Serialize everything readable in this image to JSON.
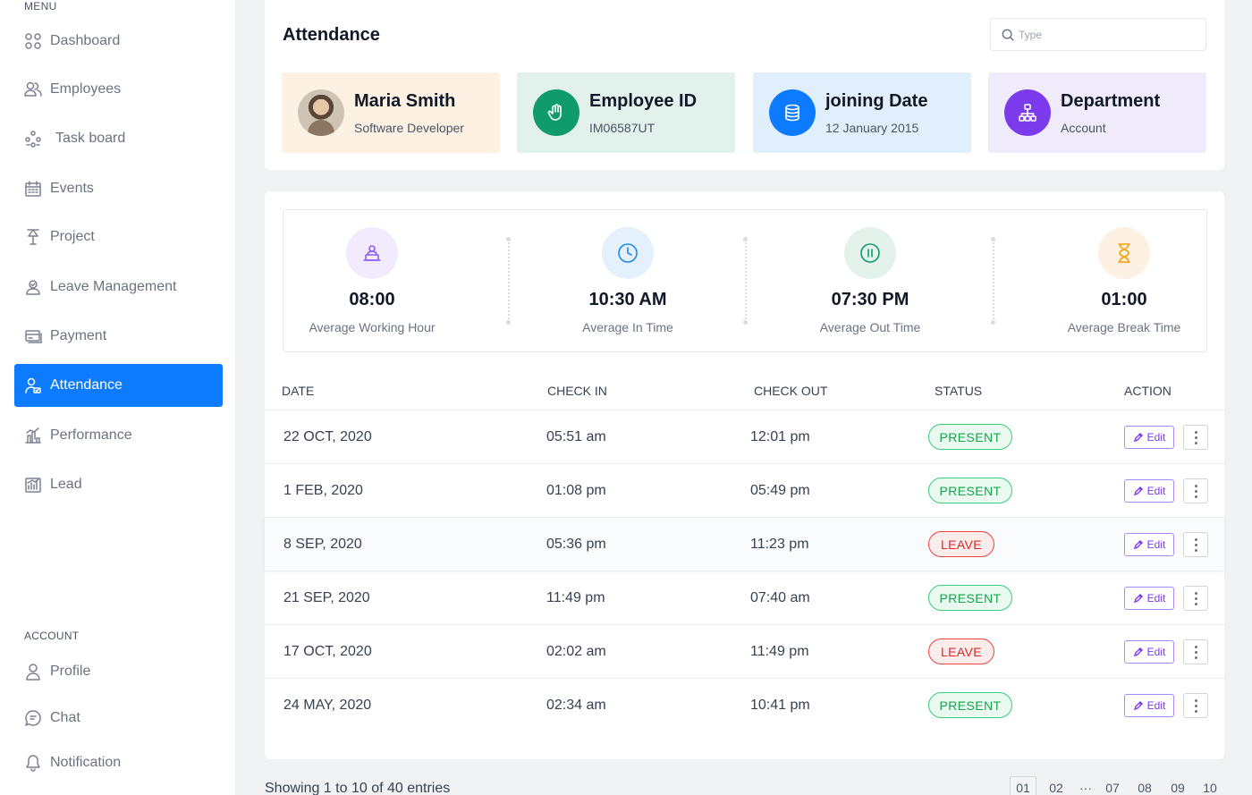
{
  "sidebar": {
    "menu_label": "MENU",
    "account_label": "ACCOUNT",
    "items": [
      {
        "label": "Dashboard",
        "icon": "grid-icon"
      },
      {
        "label": "Employees",
        "icon": "users-icon"
      },
      {
        "label": "Task board",
        "icon": "task-board-icon"
      },
      {
        "label": "Events",
        "icon": "calendar-icon"
      },
      {
        "label": "Project",
        "icon": "project-icon"
      },
      {
        "label": "Leave Management",
        "icon": "leave-icon"
      },
      {
        "label": "Payment",
        "icon": "payment-icon"
      },
      {
        "label": "Attendance",
        "icon": "attendance-icon",
        "active": true
      },
      {
        "label": "Performance",
        "icon": "performance-icon"
      },
      {
        "label": "Lead",
        "icon": "lead-icon"
      }
    ],
    "account_items": [
      {
        "label": "Profile",
        "icon": "user-icon"
      },
      {
        "label": "Chat",
        "icon": "chat-icon"
      },
      {
        "label": "Notification",
        "icon": "bell-icon"
      }
    ]
  },
  "header": {
    "title": "Attendance",
    "search_placeholder": "Type"
  },
  "info_cards": [
    {
      "title": "Maria Smith",
      "sub": "Software Developer",
      "bg": "#fdf1e3"
    },
    {
      "title": "Employee ID",
      "sub": "IM06587UT",
      "bg": "#e3f1ec",
      "badge": "#0f9b6c"
    },
    {
      "title": "joining Date",
      "sub": "12 January 2015",
      "bg": "#e1effc",
      "badge": "#0d7bff"
    },
    {
      "title": "Department",
      "sub": "Account",
      "bg": "#efebfb",
      "badge": "#7c3aed"
    }
  ],
  "stats": [
    {
      "value": "08:00",
      "label": "Average Working Hour"
    },
    {
      "value": "10:30 AM",
      "label": "Average In Time"
    },
    {
      "value": "07:30 PM",
      "label": "Average Out Time"
    },
    {
      "value": "01:00",
      "label": "Average Break Time"
    }
  ],
  "table": {
    "headers": [
      "DATE",
      "CHECK IN",
      "CHECK OUT",
      "STATUS",
      "ACTION"
    ],
    "rows": [
      {
        "date": "22 OCT, 2020",
        "in": "05:51 am",
        "out": "12:01 pm",
        "status": "PRESENT"
      },
      {
        "date": "1 FEB, 2020",
        "in": "01:08 pm",
        "out": "05:49 pm",
        "status": "PRESENT"
      },
      {
        "date": "8 SEP, 2020",
        "in": "05:36 pm",
        "out": "11:23 pm",
        "status": "LEAVE"
      },
      {
        "date": "21 SEP, 2020",
        "in": "11:49 pm",
        "out": "07:40 am",
        "status": "PRESENT"
      },
      {
        "date": "17 OCT, 2020",
        "in": "02:02 am",
        "out": "11:49 pm",
        "status": "LEAVE"
      },
      {
        "date": "24 MAY, 2020",
        "in": "02:34 am",
        "out": "10:41 pm",
        "status": "PRESENT"
      }
    ],
    "edit_label": "Edit"
  },
  "footer": {
    "showing": "Showing 1 to 10 of 40 entries",
    "pages": [
      "01",
      "02",
      "···",
      "07",
      "08",
      "09",
      "10"
    ]
  },
  "colors": {
    "accent": "#0d7bff",
    "present": "#16a34a",
    "leave": "#dc2626",
    "edit": "#7c3aed"
  }
}
